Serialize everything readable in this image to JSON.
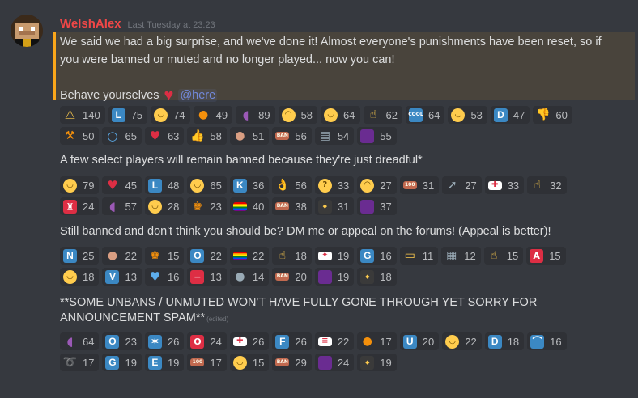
{
  "message": {
    "author": "WelshAlex",
    "timestamp": "Last Tuesday at 23:23",
    "announcement_lines": [
      "We said we had a big surprise, and we've done it! Almost everyone's punishments have been reset, so if",
      "you were banned or muted and no longer played... now you can!"
    ],
    "behave_text": "Behave yourselves",
    "mention": "@here",
    "line2": "A few select players will remain banned because they're just dreadful*",
    "line3": "Still banned and don't think you should be? DM me or appeal on the forums! (Appeal is better)!",
    "line4a": "**SOME UNBANS / UNMUTED WON'T HAVE FULLY GONE THROUGH YET SORRY FOR",
    "line4b": "ANNOUNCEMENT SPAM**",
    "edited": "(edited)"
  },
  "colors": {
    "background": "#36393f",
    "username": "#f04747",
    "mention_border": "#faa61a",
    "mention_link": "#7289da",
    "reaction_bg": "#2f3136"
  },
  "reactions": {
    "group1": [
      [
        {
          "icon": "warning-icon",
          "glyph": "⚠",
          "style": "e-warn",
          "count": "140"
        },
        {
          "icon": "letter-l-icon",
          "glyph": "L",
          "style": "e-letter",
          "count": "75"
        },
        {
          "icon": "grin-face-icon",
          "glyph": "◡",
          "style": "e-face",
          "count": "74"
        },
        {
          "icon": "flan-icon",
          "glyph": "●",
          "style": "e-orange",
          "count": "49"
        },
        {
          "icon": "eggplant-icon",
          "glyph": "◖",
          "style": "e-eggplant",
          "count": "89"
        },
        {
          "icon": "disappointed-face-icon",
          "glyph": "◠",
          "style": "e-face",
          "count": "58"
        },
        {
          "icon": "smiley-face-icon",
          "glyph": "◡",
          "style": "e-face",
          "count": "64"
        },
        {
          "icon": "middle-finger-icon",
          "glyph": "☝",
          "style": "e-hand",
          "count": "62"
        },
        {
          "icon": "cool-icon",
          "glyph": "COOL",
          "style": "e-cool",
          "count": "64"
        },
        {
          "icon": "cowboy-face-icon",
          "glyph": "◡",
          "style": "e-face",
          "count": "53"
        },
        {
          "icon": "letter-d-icon",
          "glyph": "D",
          "style": "e-letter",
          "count": "47"
        },
        {
          "icon": "thumbs-down-icon",
          "glyph": "👎",
          "style": "e-hand",
          "count": "60"
        }
      ],
      [
        {
          "icon": "hammer-icon",
          "glyph": "⚒",
          "style": "e-orange",
          "count": "50"
        },
        {
          "icon": "fearful-face-icon",
          "glyph": "○",
          "style": "e-blue-heart",
          "count": "65"
        },
        {
          "icon": "heart-icon",
          "glyph": "♥",
          "style": "e-heart",
          "count": "63"
        },
        {
          "icon": "thumbs-up-icon",
          "glyph": "👍",
          "style": "e-hand",
          "count": "58"
        },
        {
          "icon": "cookie-icon",
          "glyph": "●",
          "style": "e-brown",
          "count": "51"
        },
        {
          "icon": "banned-tag-icon",
          "glyph": "BAN",
          "style": "e-tag",
          "count": "56"
        },
        {
          "icon": "clapper-board-icon",
          "glyph": "▤",
          "style": "e-gray",
          "count": "54"
        },
        {
          "icon": "purple-block-icon",
          "glyph": "",
          "style": "e-purple",
          "count": "55"
        }
      ]
    ],
    "group2": [
      [
        {
          "icon": "grin-face-icon",
          "glyph": "◡",
          "style": "e-face",
          "count": "79"
        },
        {
          "icon": "heart-icon",
          "glyph": "♥",
          "style": "e-heart",
          "count": "45"
        },
        {
          "icon": "letter-l-icon",
          "glyph": "L",
          "style": "e-letter",
          "count": "48"
        },
        {
          "icon": "joy-face-icon",
          "glyph": "◡",
          "style": "e-face",
          "count": "65"
        },
        {
          "icon": "letter-k-icon",
          "glyph": "K",
          "style": "e-letter",
          "count": "36"
        },
        {
          "icon": "ok-hand-icon",
          "glyph": "👌",
          "style": "e-hand",
          "count": "56"
        },
        {
          "icon": "thinking-face-icon",
          "glyph": "?",
          "style": "e-face",
          "count": "33"
        },
        {
          "icon": "disappointed-face-icon",
          "glyph": "◠",
          "style": "e-face",
          "count": "27"
        },
        {
          "icon": "hundred-points-icon",
          "glyph": "100",
          "style": "e-tag",
          "count": "31"
        },
        {
          "icon": "rocket-icon",
          "glyph": "➚",
          "style": "e-gray",
          "count": "27"
        },
        {
          "icon": "uk-flag-icon",
          "glyph": "✚",
          "style": "e-flag",
          "count": "33"
        },
        {
          "icon": "middle-finger-icon",
          "glyph": "☝",
          "style": "e-hand",
          "count": "32"
        }
      ],
      [
        {
          "icon": "guardsman-icon",
          "glyph": "♜",
          "style": "e-red",
          "count": "24"
        },
        {
          "icon": "eggplant-icon",
          "glyph": "◖",
          "style": "e-eggplant",
          "count": "57"
        },
        {
          "icon": "hugging-face-icon",
          "glyph": "◡",
          "style": "e-face",
          "count": "28"
        },
        {
          "icon": "people-holding-hands-icon",
          "glyph": "♚",
          "style": "e-orange",
          "count": "23"
        },
        {
          "icon": "rainbow-flag-icon",
          "glyph": "",
          "style": "e-rainbow",
          "count": "40"
        },
        {
          "icon": "banned-tag-icon",
          "glyph": "BAN",
          "style": "e-tag",
          "count": "38"
        },
        {
          "icon": "pepe-animated-icon",
          "glyph": "◆",
          "style": "e-anim",
          "count": "31"
        },
        {
          "icon": "purple-block-icon",
          "glyph": "",
          "style": "e-purple",
          "count": "37"
        }
      ]
    ],
    "group3": [
      [
        {
          "icon": "letter-n-icon",
          "glyph": "N",
          "style": "e-letter",
          "count": "25"
        },
        {
          "icon": "cookie-icon",
          "glyph": "●",
          "style": "e-brown",
          "count": "22"
        },
        {
          "icon": "couple-icon",
          "glyph": "♚",
          "style": "e-orange",
          "count": "15"
        },
        {
          "icon": "letter-o-icon",
          "glyph": "O",
          "style": "e-letter",
          "count": "22"
        },
        {
          "icon": "rainbow-flag-icon",
          "glyph": "",
          "style": "e-rainbow",
          "count": "22"
        },
        {
          "icon": "point-up-icon",
          "glyph": "☝",
          "style": "e-hand",
          "count": "18"
        },
        {
          "icon": "canada-flag-icon",
          "glyph": "✦",
          "style": "e-flag",
          "count": "19"
        },
        {
          "icon": "letter-g-icon",
          "glyph": "G",
          "style": "e-letter",
          "count": "16"
        },
        {
          "icon": "id-card-icon",
          "glyph": "▭",
          "style": "e-hand",
          "count": "11"
        },
        {
          "icon": "calendar-icon",
          "glyph": "▦",
          "style": "e-gray",
          "count": "12"
        },
        {
          "icon": "middle-finger-icon",
          "glyph": "☝",
          "style": "e-hand",
          "count": "15"
        },
        {
          "icon": "letter-a-icon",
          "glyph": "A",
          "style": "e-red",
          "count": "15"
        }
      ],
      [
        {
          "icon": "joy-face-icon",
          "glyph": "◡",
          "style": "e-face",
          "count": "18"
        },
        {
          "icon": "letter-v-icon",
          "glyph": "V",
          "style": "e-letter",
          "count": "13"
        },
        {
          "icon": "blue-heart-icon",
          "glyph": "♥",
          "style": "e-blue-heart",
          "count": "16"
        },
        {
          "icon": "no-entry-icon",
          "glyph": "−",
          "style": "e-red",
          "count": "13"
        },
        {
          "icon": "bomb-icon",
          "glyph": "●",
          "style": "e-gray",
          "count": "14"
        },
        {
          "icon": "banned-tag-icon",
          "glyph": "BAN",
          "style": "e-tag",
          "count": "20"
        },
        {
          "icon": "purple-block-icon",
          "glyph": "",
          "style": "e-purple",
          "count": "19"
        },
        {
          "icon": "pepe-animated-icon",
          "glyph": "◆",
          "style": "e-anim",
          "count": "18"
        }
      ]
    ],
    "group4": [
      [
        {
          "icon": "eggplant-icon",
          "glyph": "◖",
          "style": "e-eggplant",
          "count": "64"
        },
        {
          "icon": "letter-o-icon",
          "glyph": "O",
          "style": "e-letter",
          "count": "23"
        },
        {
          "icon": "australia-flag-icon",
          "glyph": "✶",
          "style": "e-letter",
          "count": "26"
        },
        {
          "icon": "letter-o-red-icon",
          "glyph": "O",
          "style": "e-red",
          "count": "24"
        },
        {
          "icon": "uk-flag-icon",
          "glyph": "✚",
          "style": "e-flag",
          "count": "26"
        },
        {
          "icon": "letter-f-icon",
          "glyph": "F",
          "style": "e-letter",
          "count": "26"
        },
        {
          "icon": "us-flag-icon",
          "glyph": "≡",
          "style": "e-flag",
          "count": "22"
        },
        {
          "icon": "orange-dot-icon",
          "glyph": "●",
          "style": "e-orange",
          "count": "17"
        },
        {
          "icon": "letter-u-icon",
          "glyph": "U",
          "style": "e-letter",
          "count": "20"
        },
        {
          "icon": "rofl-face-icon",
          "glyph": "◡",
          "style": "e-face",
          "count": "22"
        },
        {
          "icon": "letter-d-icon",
          "glyph": "D",
          "style": "e-letter",
          "count": "18"
        },
        {
          "icon": "bridge-at-night-icon",
          "glyph": "⌒",
          "style": "e-letter",
          "count": "16"
        }
      ],
      [
        {
          "icon": "loop-icon",
          "glyph": "➰",
          "style": "e-orange",
          "count": "17"
        },
        {
          "icon": "letter-g-icon",
          "glyph": "G",
          "style": "e-letter",
          "count": "19"
        },
        {
          "icon": "letter-e-icon",
          "glyph": "E",
          "style": "e-letter",
          "count": "19"
        },
        {
          "icon": "hundred-points-icon",
          "glyph": "100",
          "style": "e-tag",
          "count": "17"
        },
        {
          "icon": "yum-face-icon",
          "glyph": "◡",
          "style": "e-face",
          "count": "15"
        },
        {
          "icon": "banned-tag-icon",
          "glyph": "BAN",
          "style": "e-tag",
          "count": "29"
        },
        {
          "icon": "purple-block-icon",
          "glyph": "",
          "style": "e-purple",
          "count": "24"
        },
        {
          "icon": "pepe-animated-icon",
          "glyph": "◆",
          "style": "e-anim",
          "count": "19"
        }
      ]
    ]
  }
}
